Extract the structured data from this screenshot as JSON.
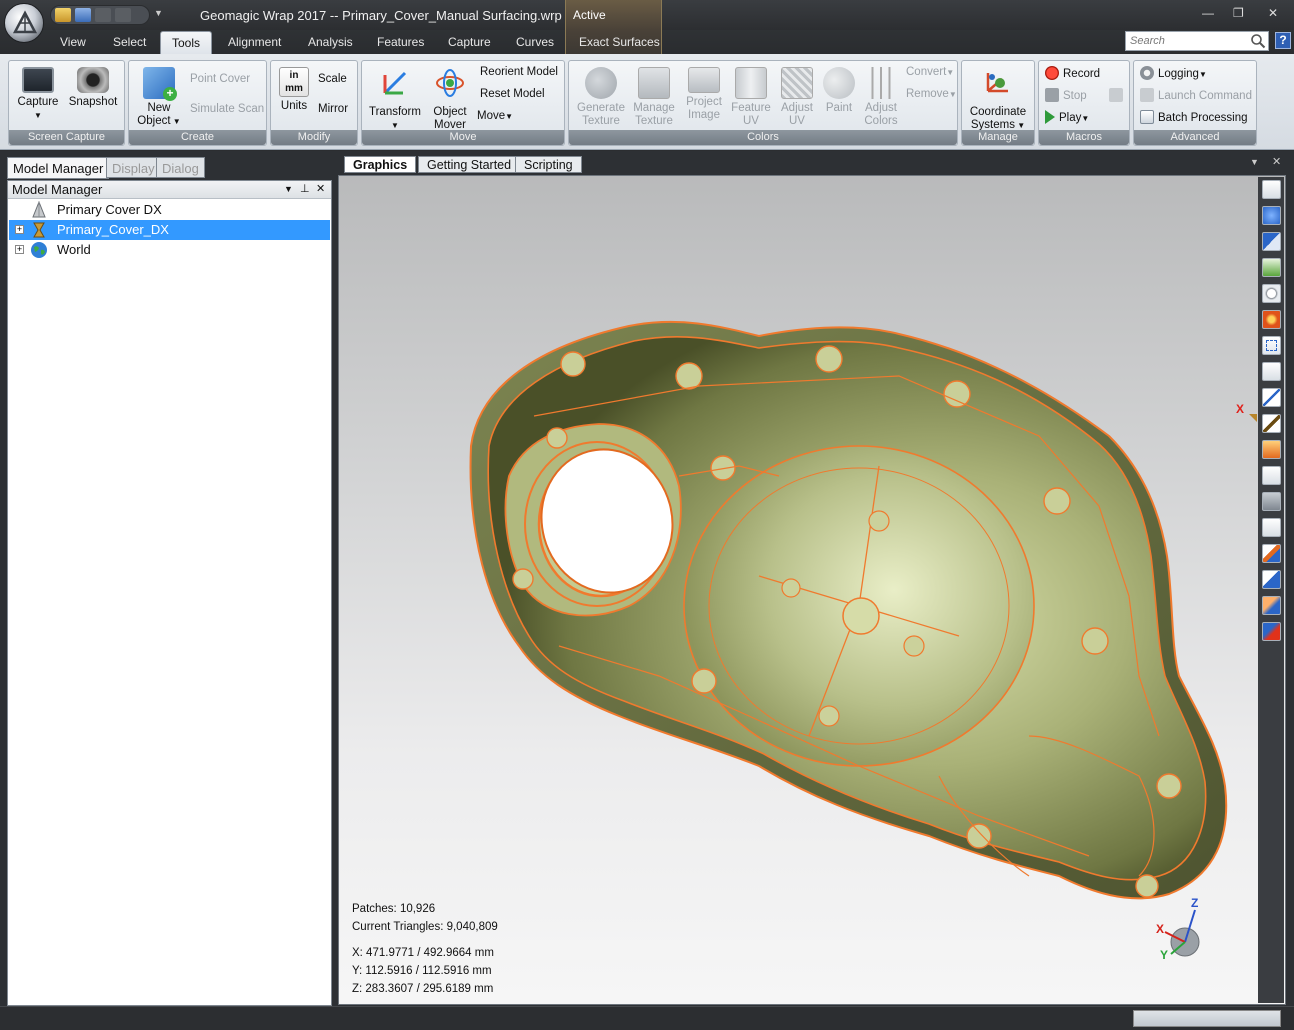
{
  "window": {
    "title": "Geomagic Wrap 2017 -- Primary_Cover_Manual Surfacing.wrp",
    "context_label": "Active",
    "minimize": "—",
    "restore": "❐",
    "close": "✕"
  },
  "tabs": {
    "view": "View",
    "select": "Select",
    "tools": "Tools",
    "alignment": "Alignment",
    "analysis": "Analysis",
    "features": "Features",
    "capture": "Capture",
    "curves": "Curves",
    "exact_surfaces": "Exact Surfaces"
  },
  "search": {
    "placeholder": "Search"
  },
  "help": "?",
  "ribbon": {
    "screen_capture": {
      "label": "Screen Capture",
      "capture": "Capture",
      "snapshot": "Snapshot"
    },
    "create": {
      "label": "Create",
      "new_object": "New Object",
      "point_cover": "Point Cover",
      "simulate_scan": "Simulate Scan"
    },
    "modify": {
      "label": "Modify",
      "units": "Units",
      "scale": "Scale",
      "mirror": "Mirror",
      "units_in": "in",
      "units_mm": "mm"
    },
    "move": {
      "label": "Move",
      "transform": "Transform",
      "object_mover": "Object Mover",
      "reorient_model": "Reorient Model",
      "reset_model": "Reset Model",
      "move": "Move"
    },
    "colors": {
      "label": "Colors",
      "generate_texture": "Generate Texture",
      "manage_texture": "Manage Texture",
      "project_image": "Project Image",
      "feature_uv": "Feature UV",
      "adjust_uv": "Adjust UV",
      "paint": "Paint",
      "adjust_colors": "Adjust Colors",
      "convert": "Convert",
      "remove": "Remove"
    },
    "manage": {
      "label": "Manage",
      "coordinate_systems": "Coordinate Systems"
    },
    "macros": {
      "label": "Macros",
      "record": "Record",
      "stop": "Stop",
      "play": "Play"
    },
    "advanced": {
      "label": "Advanced",
      "logging": "Logging",
      "launch_command": "Launch Command",
      "batch_processing": "Batch Processing"
    }
  },
  "left_panel": {
    "tabs": {
      "model_manager": "Model Manager",
      "display": "Display",
      "dialog": "Dialog"
    },
    "header": "Model Manager",
    "tree": [
      {
        "label": "Primary Cover DX",
        "selected": false
      },
      {
        "label": "Primary_Cover_DX",
        "selected": true
      },
      {
        "label": "World",
        "selected": false
      }
    ]
  },
  "graphics_tabs": {
    "graphics": "Graphics",
    "getting_started": "Getting Started",
    "scripting": "Scripting"
  },
  "viewport": {
    "patches": "Patches: 10,926",
    "triangles": "Current Triangles: 9,040,809",
    "x": "X:  471.9771 / 492.9664 mm",
    "y": "Y:  112.5916 / 112.5916 mm",
    "z": "Z:  283.3607 / 295.6189 mm",
    "axis_x": "X",
    "triad": {
      "x": "X",
      "y": "Y",
      "z": "Z"
    }
  },
  "colors": {
    "accent": "#f07a2e",
    "model": "#9ea56a",
    "selected": "#3399ff"
  }
}
